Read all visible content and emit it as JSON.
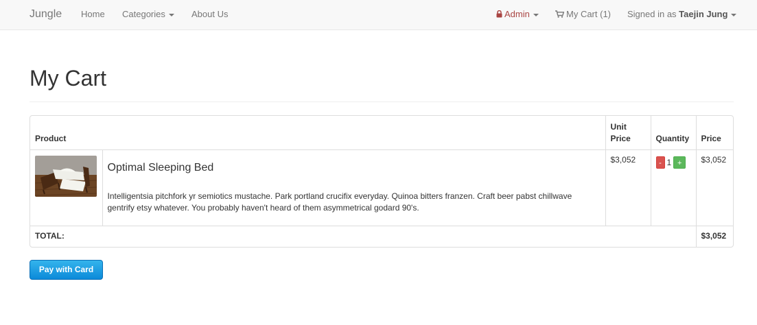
{
  "navbar": {
    "brand": "Jungle",
    "home": "Home",
    "categories": "Categories",
    "about": "About Us",
    "admin": "Admin",
    "cart": "My Cart (1)",
    "signed_in_prefix": "Signed in as ",
    "user_name": "Taejin Jung",
    "colors": {
      "background": "#f8f8f8",
      "admin": "#a94442",
      "link": "#777777"
    },
    "icons": {
      "admin": "lock-icon",
      "cart": "shopping-cart-icon"
    }
  },
  "page": {
    "title": "My Cart"
  },
  "table": {
    "headers": {
      "product": "Product",
      "unit_price": "Unit Price",
      "quantity": "Quantity",
      "price": "Price"
    },
    "items": [
      {
        "name": "Optimal Sleeping Bed",
        "description": "Intelligentsia pitchfork yr semiotics mustache. Park portland crucifix everyday. Quinoa bitters franzen. Craft beer pabst chillwave gentrify etsy whatever. You probably haven't heard of them asymmetrical godard 90's.",
        "unit_price": "$3,052",
        "quantity": "1",
        "decrement_label": "-",
        "increment_label": "+",
        "price": "$3,052"
      }
    ],
    "total_label": "TOTAL:",
    "total_value": "$3,052"
  },
  "checkout": {
    "button_label": "Pay with Card",
    "color": "#0c8ad9"
  }
}
